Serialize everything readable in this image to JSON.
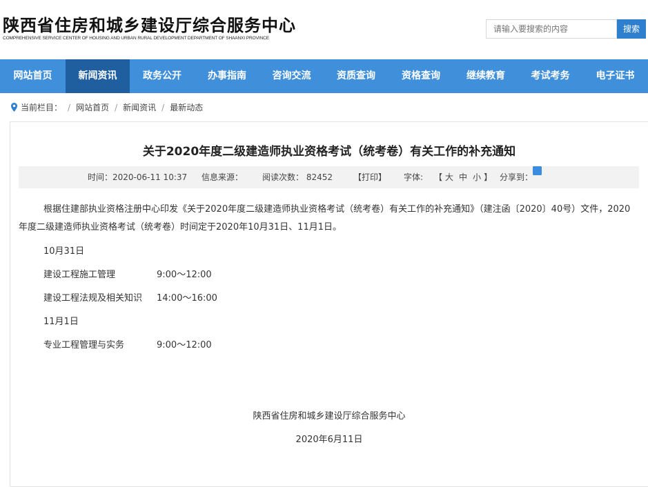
{
  "header": {
    "title": "陕西省住房和城乡建设厅综合服务中心",
    "subtitle": "COMPREHENSIVE SERVICE CENTER OF HOUSING AND URBAN RURAL DEVELOPMENT DEPARTMENT OF SHAANXI PROVINCE",
    "search_placeholder": "请输入要搜索的内容",
    "search_button": "搜索"
  },
  "nav": {
    "items": [
      {
        "label": "网站首页"
      },
      {
        "label": "新闻资讯"
      },
      {
        "label": "政务公开"
      },
      {
        "label": "办事指南"
      },
      {
        "label": "咨询交流"
      },
      {
        "label": "资质查询"
      },
      {
        "label": "资格查询"
      },
      {
        "label": "继续教育"
      },
      {
        "label": "考试考务"
      },
      {
        "label": "电子证书"
      }
    ],
    "active_index": 1
  },
  "breadcrumb": {
    "label": "当前栏目：",
    "items": [
      "网站首页",
      "新闻资讯",
      "最新动态"
    ]
  },
  "article": {
    "title": "关于2020年度二级建造师执业资格考试（统考卷）有关工作的补充通知",
    "meta": {
      "time": "时间：2020-06-11 10:37",
      "source": "信息来源：",
      "reads": "阅读次数： 82452",
      "print": "【打印】",
      "font_label": "字体:",
      "font_open": "【",
      "font_large": "大",
      "font_medium": "中",
      "font_small": "小",
      "font_close": "】",
      "share_label": "分享到："
    },
    "paragraph": "根据住建部执业资格注册中心印发《关于2020年度二级建造师执业资格考试（统考卷）有关工作的补充通知》（建注函〔2020〕40号）文件，2020年度二级建造师执业资格考试（统考卷）时间定于2020年10月31日、11月1日。",
    "schedule": [
      {
        "date": "10月31日"
      },
      {
        "subject": "建设工程施工管理",
        "time": "9:00～12:00"
      },
      {
        "subject": "建设工程法规及相关知识",
        "time": "14:00～16:00"
      },
      {
        "date": "11月1日"
      },
      {
        "subject": "专业工程管理与实务",
        "time": "9:00～12:00"
      }
    ],
    "signature": "陕西省住房和城乡建设厅综合服务中心",
    "date": "2020年6月11日"
  },
  "colors": {
    "nav_bg": "#3f8fdb",
    "nav_active": "#1f5f9f",
    "search_btn": "#2f7fcf",
    "meta_bg": "#f2f2f2"
  },
  "icons": [
    "location-icon",
    "wechat-icon",
    "weibo-icon",
    "share-more-icon"
  ]
}
